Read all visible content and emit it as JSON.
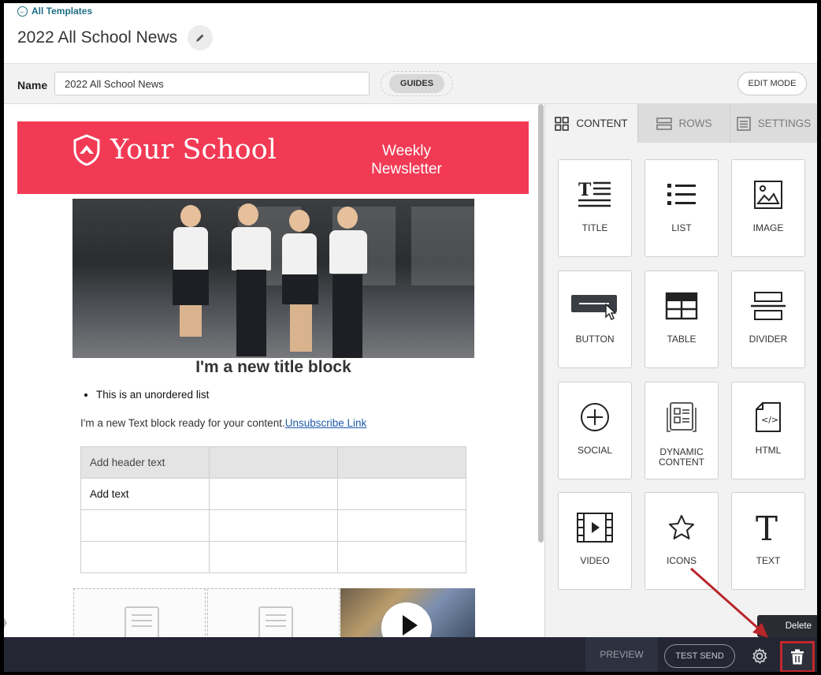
{
  "header": {
    "back_link": "All Templates",
    "title": "2022 All School News"
  },
  "name_bar": {
    "label": "Name",
    "value": "2022 All School News",
    "guides": "GUIDES",
    "edit_mode": "EDIT MODE"
  },
  "newsletter": {
    "school_name": "Your School",
    "newsletter_line1": "Weekly",
    "newsletter_line2": "Newsletter",
    "title_block": "I'm a new title block",
    "list_item": "This is an unordered list",
    "text_block": "I'm a new Text block ready for your content.",
    "unsubscribe": "Unsubscribe Link",
    "table": {
      "header": [
        "Add header text",
        "",
        ""
      ],
      "rows": [
        [
          "Add text",
          "",
          ""
        ],
        [
          "",
          "",
          ""
        ],
        [
          "",
          "",
          ""
        ]
      ]
    }
  },
  "panel": {
    "tabs": [
      {
        "label": "CONTENT",
        "icon": "grid-icon",
        "active": true
      },
      {
        "label": "ROWS",
        "icon": "rows-icon",
        "active": false
      },
      {
        "label": "SETTINGS",
        "icon": "settings-icon",
        "active": false
      }
    ],
    "blocks": [
      {
        "label": "TITLE",
        "icon": "title-icon"
      },
      {
        "label": "LIST",
        "icon": "list-icon"
      },
      {
        "label": "IMAGE",
        "icon": "image-icon"
      },
      {
        "label": "BUTTON",
        "icon": "button-icon"
      },
      {
        "label": "TABLE",
        "icon": "table-icon"
      },
      {
        "label": "DIVIDER",
        "icon": "divider-icon"
      },
      {
        "label": "SOCIAL",
        "icon": "social-icon"
      },
      {
        "label": "DYNAMIC CONTENT",
        "icon": "dynamic-content-icon"
      },
      {
        "label": "HTML",
        "icon": "html-icon"
      },
      {
        "label": "VIDEO",
        "icon": "video-icon"
      },
      {
        "label": "ICONS",
        "icon": "star-icon"
      },
      {
        "label": "TEXT",
        "icon": "text-icon"
      }
    ]
  },
  "bottom_bar": {
    "preview": "PREVIEW",
    "test_send": "TEST SEND",
    "tooltip": "Delete"
  },
  "colors": {
    "banner": "#f23a55",
    "link": "#1f6f84",
    "bottom_bar": "#242733",
    "highlight": "#c3272c"
  }
}
